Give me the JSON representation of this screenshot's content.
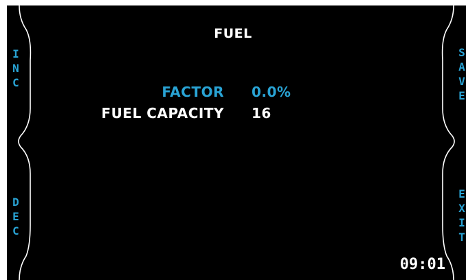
{
  "screen": {
    "title": "FUEL",
    "time": "09:01"
  },
  "buttons": {
    "left_top": [
      "I",
      "N",
      "C"
    ],
    "left_bottom": [
      "D",
      "E",
      "C"
    ],
    "right_top": [
      "S",
      "A",
      "V",
      "E"
    ],
    "right_bottom": [
      "E",
      "X",
      "I",
      "T"
    ]
  },
  "fields": [
    {
      "label": "FACTOR",
      "value": "0.0%",
      "selected": true
    },
    {
      "label": "FUEL CAPACITY",
      "value": "16",
      "selected": false
    }
  ],
  "colors": {
    "accent": "#29a3d4",
    "text": "#ffffff",
    "background": "#000000"
  }
}
